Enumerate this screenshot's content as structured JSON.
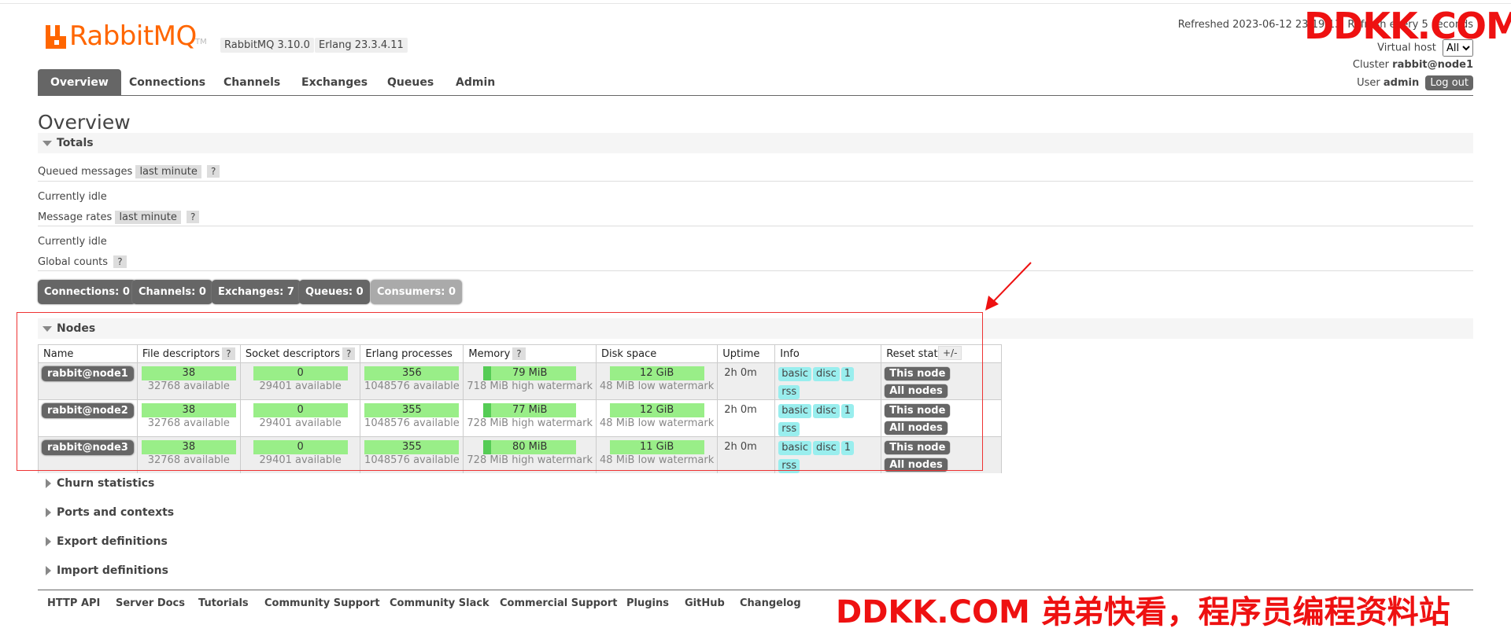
{
  "header": {
    "logo_text": "RabbitMQ",
    "logo_tm": "TM",
    "rabbitmq_version": "RabbitMQ 3.10.0",
    "erlang_version": "Erlang 23.3.4.11",
    "refreshed": "Refreshed 2023-06-12 23:19:13",
    "refresh_suffix": "Refresh every 5 seconds",
    "virtual_host_label": "Virtual host",
    "virtual_host_value": "All",
    "cluster_label": "Cluster",
    "cluster_value": "rabbit@node1",
    "user_label": "User",
    "user_value": "admin",
    "logout_label": "Log out"
  },
  "tabs": [
    "Overview",
    "Connections",
    "Channels",
    "Exchanges",
    "Queues",
    "Admin"
  ],
  "page_title": "Overview",
  "totals": {
    "heading": "Totals",
    "queued_label": "Queued messages",
    "queued_range": "last minute",
    "help": "?",
    "idle1": "Currently idle",
    "rates_label": "Message rates",
    "rates_range": "last minute",
    "idle2": "Currently idle",
    "global_label": "Global counts"
  },
  "counts": [
    {
      "label": "Connections:",
      "value": "0"
    },
    {
      "label": "Channels:",
      "value": "0"
    },
    {
      "label": "Exchanges:",
      "value": "7"
    },
    {
      "label": "Queues:",
      "value": "0"
    },
    {
      "label": "Consumers:",
      "value": "0"
    }
  ],
  "nodes": {
    "heading": "Nodes",
    "plusminus": "+/-",
    "columns": [
      "Name",
      "File descriptors",
      "Socket descriptors",
      "Erlang processes",
      "Memory",
      "Disk space",
      "Uptime",
      "Info",
      "Reset stats"
    ],
    "rows": [
      {
        "name": "rabbit@node1",
        "fd": "38",
        "fd_avail": "32768 available",
        "sd": "0",
        "sd_avail": "29401 available",
        "ep": "356",
        "ep_avail": "1048576 available",
        "mem": "79 MiB",
        "mem_wm": "718 MiB high watermark",
        "disk": "12 GiB",
        "disk_wm": "48 MiB low watermark",
        "uptime": "2h 0m",
        "info": [
          "basic",
          "disc",
          "1",
          "rss"
        ],
        "reset": [
          "This node",
          "All nodes"
        ]
      },
      {
        "name": "rabbit@node2",
        "fd": "38",
        "fd_avail": "32768 available",
        "sd": "0",
        "sd_avail": "29401 available",
        "ep": "355",
        "ep_avail": "1048576 available",
        "mem": "77 MiB",
        "mem_wm": "728 MiB high watermark",
        "disk": "12 GiB",
        "disk_wm": "48 MiB low watermark",
        "uptime": "2h 0m",
        "info": [
          "basic",
          "disc",
          "1",
          "rss"
        ],
        "reset": [
          "This node",
          "All nodes"
        ]
      },
      {
        "name": "rabbit@node3",
        "fd": "38",
        "fd_avail": "32768 available",
        "sd": "0",
        "sd_avail": "29401 available",
        "ep": "355",
        "ep_avail": "1048576 available",
        "mem": "80 MiB",
        "mem_wm": "728 MiB high watermark",
        "disk": "11 GiB",
        "disk_wm": "48 MiB low watermark",
        "uptime": "2h 0m",
        "info": [
          "basic",
          "disc",
          "1",
          "rss"
        ],
        "reset": [
          "This node",
          "All nodes"
        ]
      }
    ]
  },
  "collapsed_sections": [
    "Churn statistics",
    "Ports and contexts",
    "Export definitions",
    "Import definitions"
  ],
  "footer_links": [
    "HTTP API",
    "Server Docs",
    "Tutorials",
    "Community Support",
    "Community Slack",
    "Commercial Support",
    "Plugins",
    "GitHub",
    "Changelog"
  ],
  "watermark": {
    "top": "DDKK.COM",
    "bottom": "DDKK.COM 弟弟快看，程序员编程资料站"
  },
  "colors": {
    "accent": "#ff6600",
    "tab_active": "#666666",
    "gauge": "#99ee88",
    "annotation": "#ee1111"
  }
}
